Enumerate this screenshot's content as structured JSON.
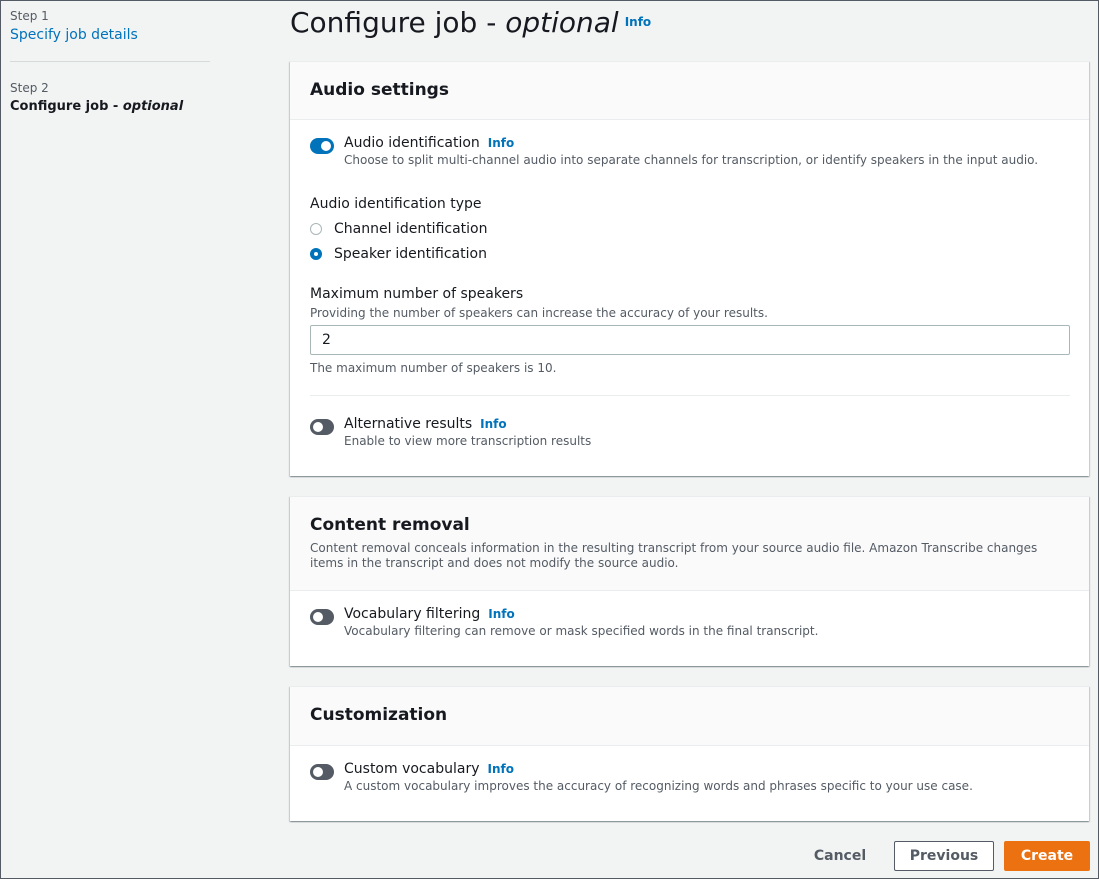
{
  "nav": {
    "step1": {
      "number": "Step 1",
      "label": "Specify job details"
    },
    "step2": {
      "number": "Step 2",
      "label_main": "Configure job",
      "label_sep": " - ",
      "label_optional": "optional"
    }
  },
  "page": {
    "title_main": "Configure job",
    "title_sep": " - ",
    "title_optional": "optional",
    "info": "Info"
  },
  "audio_settings": {
    "title": "Audio settings",
    "audio_identification": {
      "label": "Audio identification",
      "info": "Info",
      "description": "Choose to split multi-channel audio into separate channels for transcription, or identify speakers in the input audio.",
      "enabled": true
    },
    "identification_type": {
      "label": "Audio identification type",
      "options": [
        "Channel identification",
        "Speaker identification"
      ],
      "selected": "Speaker identification"
    },
    "max_speakers": {
      "label": "Maximum number of speakers",
      "description": "Providing the number of speakers can increase the accuracy of your results.",
      "value": "2",
      "constraint": "The maximum number of speakers is 10."
    },
    "alternative_results": {
      "label": "Alternative results",
      "info": "Info",
      "description": "Enable to view more transcription results",
      "enabled": false
    }
  },
  "content_removal": {
    "title": "Content removal",
    "description": "Content removal conceals information in the resulting transcript from your source audio file. Amazon Transcribe changes items in the transcript and does not modify the source audio.",
    "vocabulary_filtering": {
      "label": "Vocabulary filtering",
      "info": "Info",
      "description": "Vocabulary filtering can remove or mask specified words in the final transcript.",
      "enabled": false
    }
  },
  "customization": {
    "title": "Customization",
    "custom_vocabulary": {
      "label": "Custom vocabulary",
      "info": "Info",
      "description": "A custom vocabulary improves the accuracy of recognizing words and phrases specific to your use case.",
      "enabled": false
    }
  },
  "actions": {
    "cancel": "Cancel",
    "previous": "Previous",
    "create": "Create"
  },
  "colors": {
    "link": "#0073bb",
    "primary_button": "#ec7211",
    "toggle_off": "#545b64",
    "toggle_on": "#0073bb"
  }
}
